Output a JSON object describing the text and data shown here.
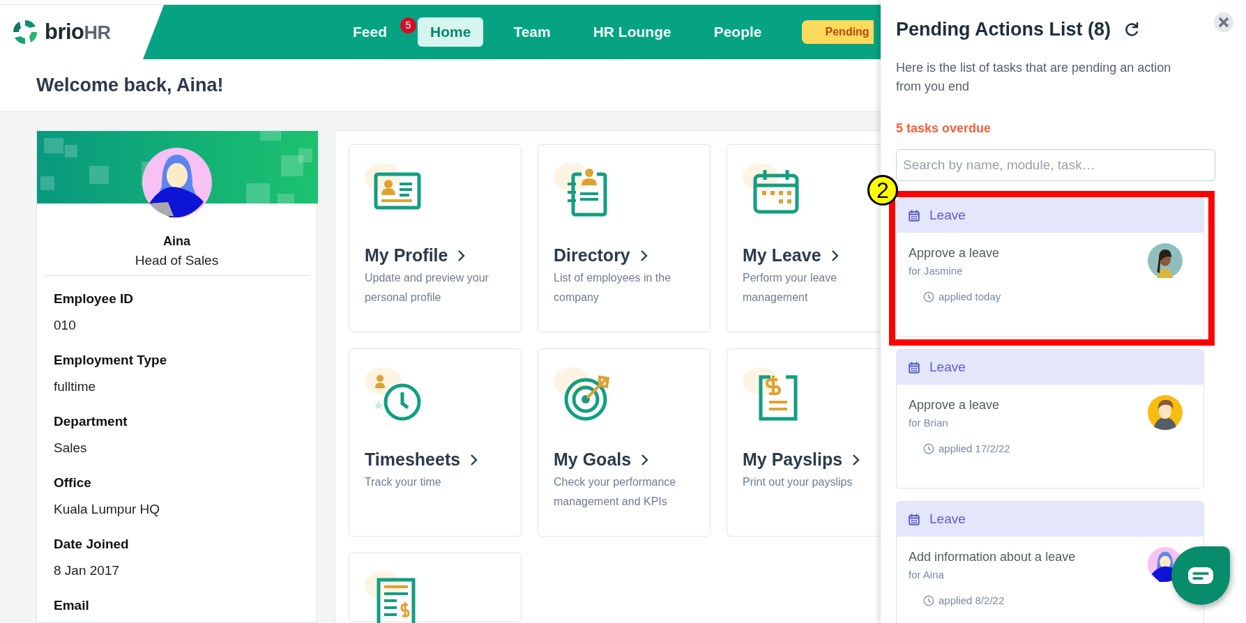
{
  "header": {
    "logo": {
      "brand": "brio",
      "suffix": "HR"
    },
    "nav": [
      {
        "label": "Feed",
        "selected": false,
        "badge": "5"
      },
      {
        "label": "Home",
        "selected": true
      },
      {
        "label": "Team",
        "selected": false
      },
      {
        "label": "HR Lounge",
        "selected": false
      },
      {
        "label": "People",
        "selected": false
      }
    ],
    "pending_button": "Pending"
  },
  "welcome": "Welcome back, Aina!",
  "profile": {
    "name": "Aina",
    "job_title": "Head of Sales",
    "fields": [
      {
        "label": "Employee ID",
        "value": "010"
      },
      {
        "label": "Employment Type",
        "value": "fulltime"
      },
      {
        "label": "Department",
        "value": "Sales"
      },
      {
        "label": "Office",
        "value": "Kuala Lumpur HQ"
      },
      {
        "label": "Date Joined",
        "value": "8 Jan 2017"
      },
      {
        "label": "Email"
      }
    ]
  },
  "tiles": [
    {
      "kind": "full",
      "title": "My Profile",
      "description": "Update and preview your personal profile"
    },
    {
      "kind": "full",
      "title": "Directory",
      "description": "List of employees in the company"
    },
    {
      "kind": "full",
      "title": "My Leave",
      "description": "Perform your leave management"
    },
    {
      "kind": "full",
      "title": "Timesheets",
      "description": "Track your time"
    },
    {
      "kind": "full",
      "title": "My Goals",
      "description": "Check your performance management and KPIs"
    },
    {
      "kind": "full",
      "title": "My Payslips",
      "description": "Print out your payslips"
    },
    {
      "kind": "icon_only"
    }
  ],
  "pending_panel": {
    "title": "Pending Actions List (8)",
    "description": "Here is the list of tasks that are pending an action from you end",
    "overdue": "5 tasks overdue",
    "search": {
      "placeholder": "Search by name, module, task…"
    },
    "cards": [
      {
        "module": "Leave",
        "task": "Approve a leave",
        "for": "for Jasmine",
        "applied": "applied today",
        "highlighted": true,
        "callout": "2"
      },
      {
        "module": "Leave",
        "task": "Approve a leave",
        "for": "for Brian",
        "applied": "applied 17/2/22",
        "highlighted": false
      },
      {
        "module": "Leave",
        "task": "Add information about a leave",
        "for": "for Aina",
        "applied": "applied 8/2/22",
        "highlighted": false
      }
    ]
  }
}
